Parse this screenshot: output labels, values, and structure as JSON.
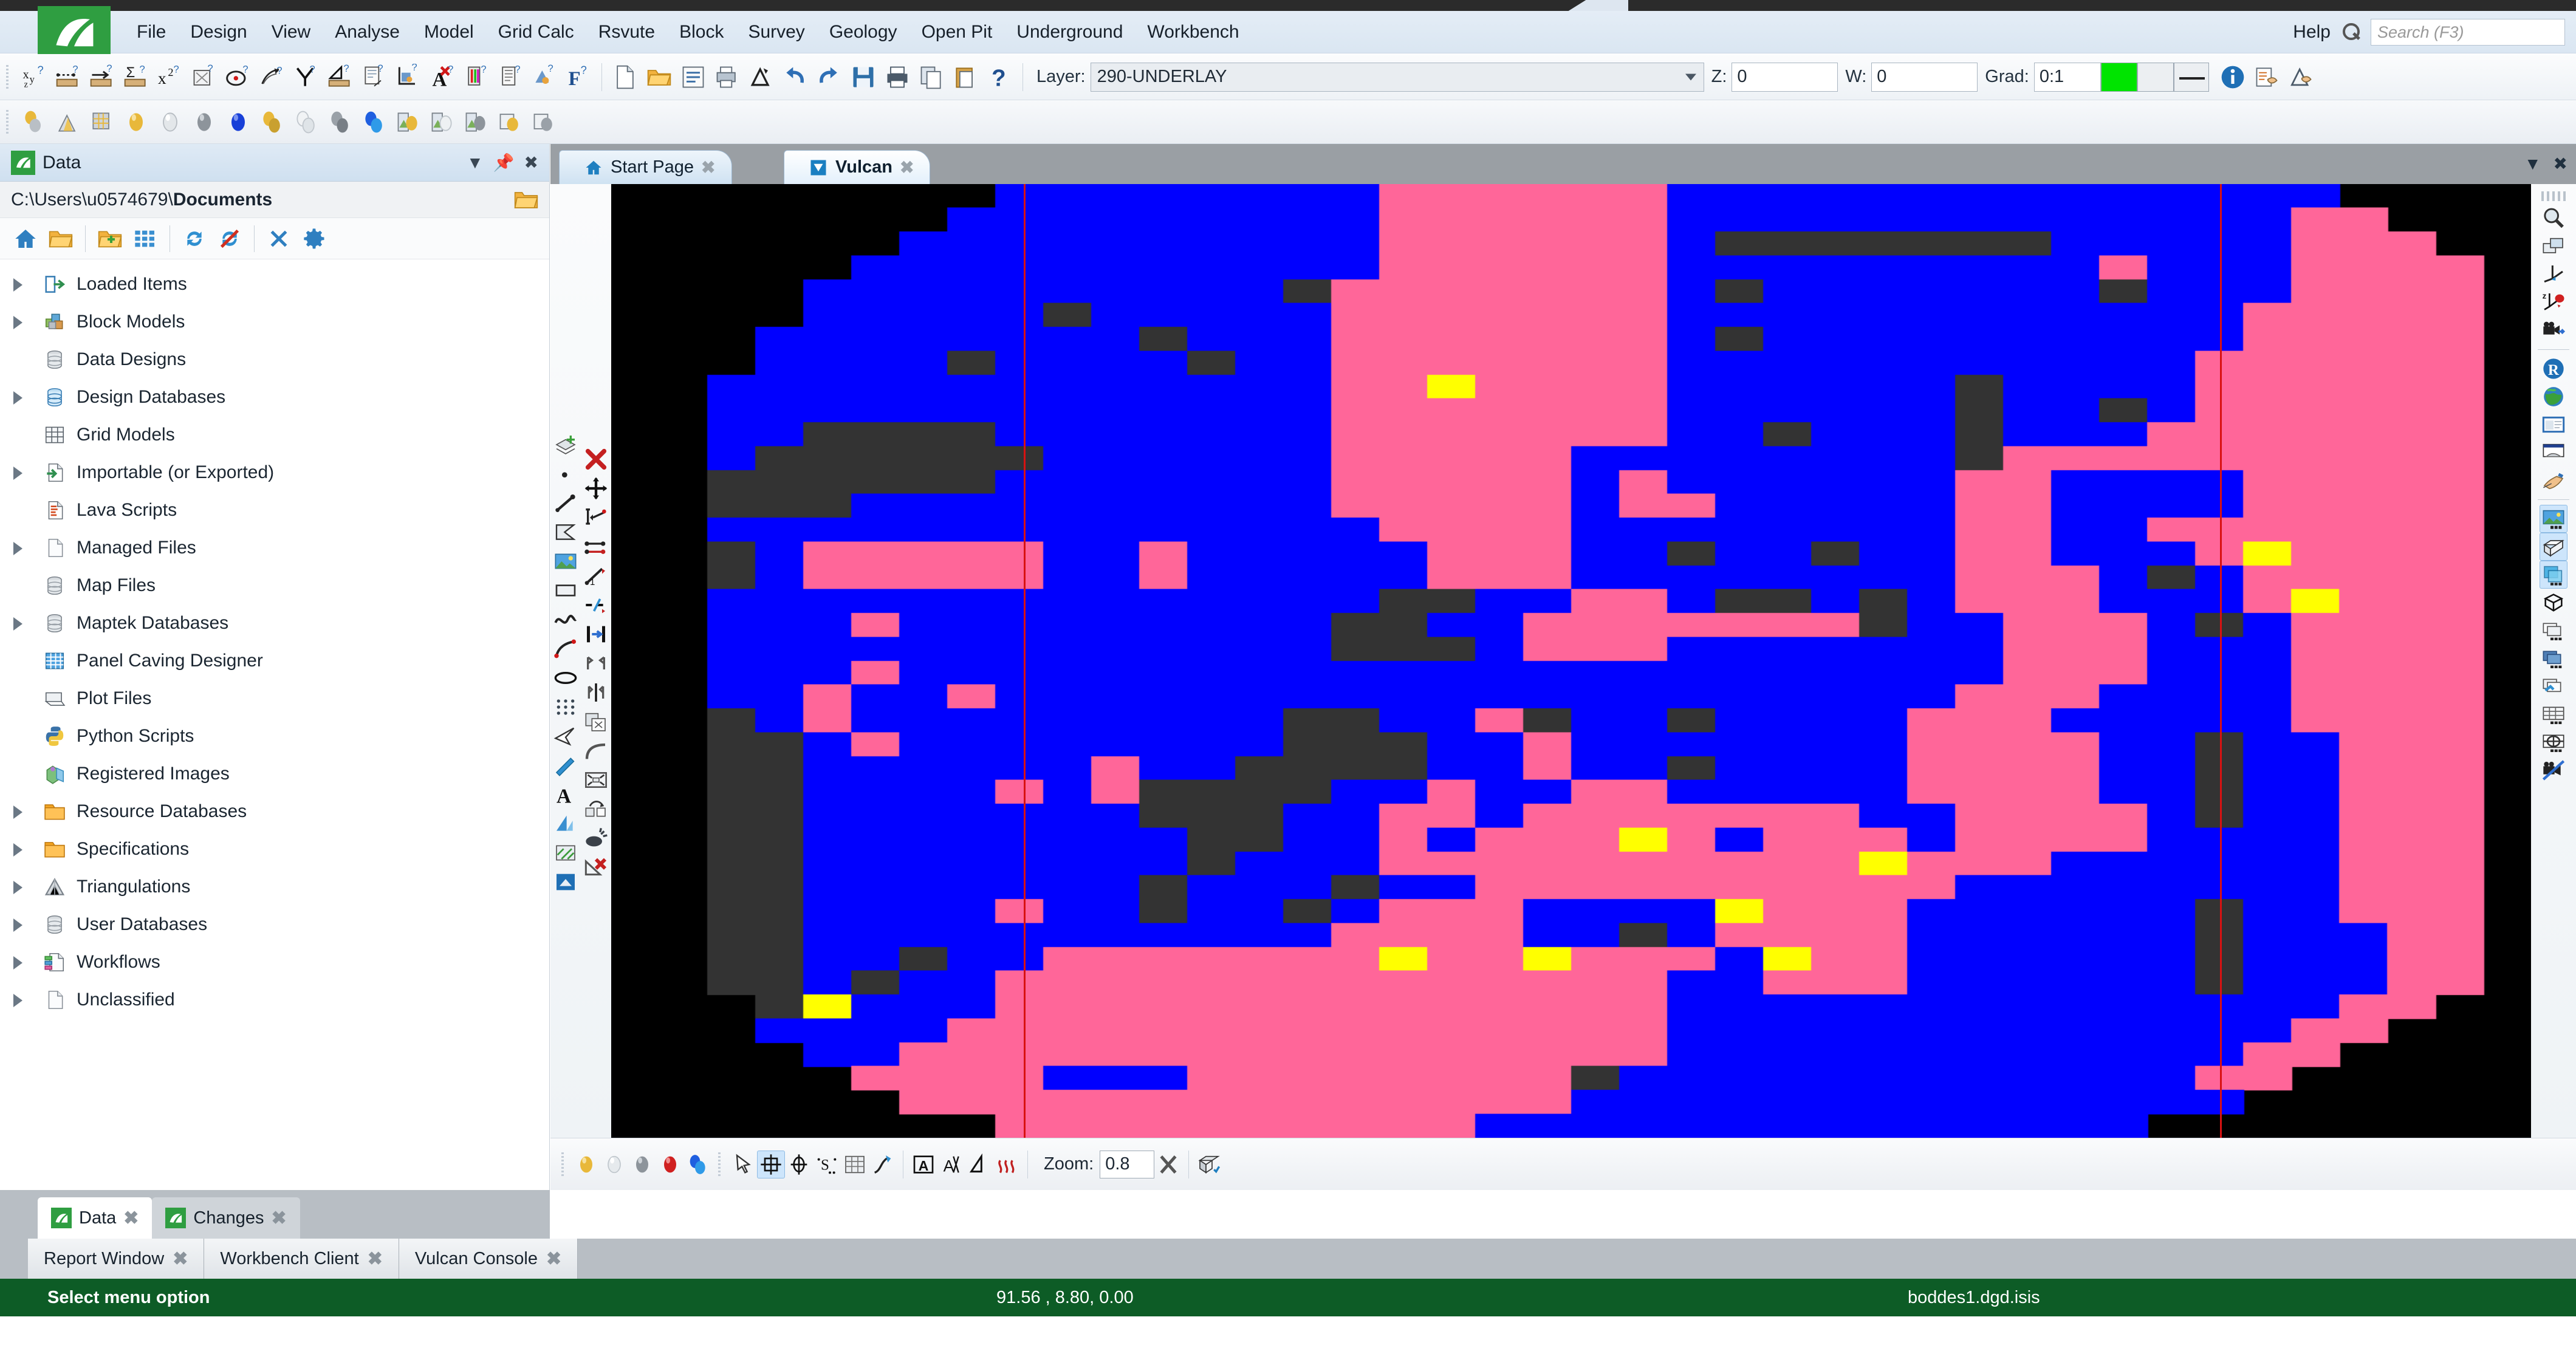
{
  "app": {
    "logo_alt": "maptek-vulcan-logo",
    "menu": [
      "File",
      "Design",
      "View",
      "Analyse",
      "Model",
      "Grid Calc",
      "Rsvute",
      "Block",
      "Survey",
      "Geology",
      "Open Pit",
      "Underground",
      "Workbench"
    ],
    "help_label": "Help",
    "search": {
      "placeholder": "Search (F3)",
      "value": ""
    }
  },
  "toolbar": {
    "layer_label": "Layer:",
    "layer_value": "290-UNDERLAY",
    "z_label": "Z:",
    "z_value": "0",
    "w_label": "W:",
    "w_value": "0",
    "grad_label": "Grad:",
    "grad_value": "0:1",
    "grad_color": "#00e400",
    "row1_icons": [
      "xyz-label-icon",
      "distance-measure-icon",
      "arrow-measure-icon",
      "sum-measure-icon",
      "x-squared-icon",
      "area-query-icon",
      "point-query-icon",
      "surface-query-icon",
      "angle-query-icon",
      "triangle-measure-icon",
      "document-measure-icon",
      "chart-axis-icon",
      "delete-text-icon",
      "colour-legend-icon",
      "report-icon",
      "legend-edit-icon",
      "formula-icon"
    ],
    "row2_icons": [
      "spheres-icon",
      "triangulation-icon",
      "grid-model-icon",
      "gold-sphere-icon",
      "white-sphere-icon",
      "grey-sphere-icon",
      "blue-sphere-icon",
      "gold-spheres-icon",
      "white-spheres-icon",
      "grey-spheres-icon",
      "blue-spheres-icon",
      "gold-section-icon",
      "white-section-icon",
      "grey-section-icon",
      "gold-copy-icon",
      "grey-copy-icon"
    ],
    "file_icons": [
      "new-file-icon",
      "open-folder-icon",
      "list-icon",
      "print-preview-icon",
      "delta-icon",
      "undo-icon",
      "redo-icon",
      "save-icon",
      "print-icon",
      "copy-icon",
      "paste-icon",
      "help-question-icon"
    ],
    "right_icons": [
      "info-icon",
      "properties-icon",
      "edit-properties-icon"
    ]
  },
  "data_panel": {
    "title": "Data",
    "icon": "vulcan-leaf-icon",
    "path_prefix": "C:\\Users\\u0574679\\",
    "path_bold": "Documents",
    "pin_icon": "pin-icon",
    "close_icon": "close-icon",
    "dropdown_icon": "chevron-down-icon",
    "folder_icon": "folder-open-icon",
    "tools": [
      "home-icon",
      "open-folder-icon",
      "new-folder-icon",
      "grid-view-icon",
      "refresh-icon",
      "refresh-off-icon",
      "collapse-icon",
      "settings-gear-icon"
    ],
    "tree": [
      {
        "label": "Loaded Items",
        "icon": "loaded-items-icon",
        "expandable": true
      },
      {
        "label": "Block Models",
        "icon": "block-models-icon",
        "expandable": true
      },
      {
        "label": "Data Designs",
        "icon": "database-grey-icon",
        "expandable": false
      },
      {
        "label": "Design Databases",
        "icon": "database-blue-icon",
        "expandable": true
      },
      {
        "label": "Grid Models",
        "icon": "grid-models-icon",
        "expandable": false
      },
      {
        "label": "Importable (or Exported)",
        "icon": "import-file-icon",
        "expandable": true
      },
      {
        "label": "Lava Scripts",
        "icon": "lava-script-icon",
        "expandable": false
      },
      {
        "label": "Managed Files",
        "icon": "file-blank-icon",
        "expandable": true
      },
      {
        "label": "Map Files",
        "icon": "database-grey-icon",
        "expandable": false
      },
      {
        "label": "Maptek Databases",
        "icon": "database-grey-icon",
        "expandable": true
      },
      {
        "label": "Panel Caving Designer",
        "icon": "panel-caving-icon",
        "expandable": false
      },
      {
        "label": "Plot Files",
        "icon": "plot-file-icon",
        "expandable": false
      },
      {
        "label": "Python Scripts",
        "icon": "python-icon",
        "expandable": false
      },
      {
        "label": "Registered Images",
        "icon": "registered-images-icon",
        "expandable": false
      },
      {
        "label": "Resource Databases",
        "icon": "folder-orange-icon",
        "expandable": true
      },
      {
        "label": "Specifications",
        "icon": "folder-orange-icon",
        "expandable": true
      },
      {
        "label": "Triangulations",
        "icon": "triangulation-icon",
        "expandable": true
      },
      {
        "label": "User Databases",
        "icon": "database-grey-icon",
        "expandable": true
      },
      {
        "label": "Workflows",
        "icon": "workflow-icon",
        "expandable": true
      },
      {
        "label": "Unclassified",
        "icon": "file-blank-icon",
        "expandable": true
      }
    ],
    "dock_tabs": [
      {
        "label": "Data",
        "active": true,
        "icon": "vulcan-leaf-icon",
        "close": "✖"
      },
      {
        "label": "Changes",
        "active": false,
        "icon": "vulcan-leaf-icon",
        "close": "✖"
      }
    ]
  },
  "viewport": {
    "tabs": [
      {
        "label": "Start Page",
        "icon": "home-icon",
        "active": false,
        "close": "✖"
      },
      {
        "label": "Vulcan",
        "icon": "vulcan-triangle-icon",
        "active": true,
        "close": "✖"
      }
    ],
    "tabbar_right": {
      "minimise": "▼",
      "close": "✖"
    },
    "left_tools_col1": [
      "add-layer-icon",
      "point-icon",
      "line-icon",
      "polygon-icon",
      "image-icon",
      "rectangle-icon",
      "spline-icon",
      "arc-icon",
      "ellipse-icon",
      "point-array-icon",
      "select-arrow-icon",
      "blue-arrow-icon",
      "text-icon",
      "extrude-icon",
      "hatch-icon",
      "solid-icon"
    ],
    "left_tools_col2": [
      "delete-red-x-icon",
      "move-icon",
      "snap-icon",
      "edit-points-icon",
      "offset-icon",
      "trim-icon",
      "extend-icon",
      "mirror-icon",
      "split-icon",
      "copy-object-icon",
      "curve-icon",
      "scale-icon",
      "duplicate-icon",
      "explode-icon",
      "delete-triangle-icon"
    ],
    "right_tools": [
      "zoom-icon",
      "window-zoom-icon",
      "axis-view-icon",
      "z-axis-rotate-icon",
      "camera-icon",
      "reset-view-icon",
      "globe-icon",
      "layout-icon",
      "presentation-icon",
      "pan-hand-icon",
      "image-display-icon",
      "solid-display-icon",
      "transparency-icon",
      "wireframe-icon",
      "layers-white-icon",
      "layers-blue-icon",
      "layers-edit-icon",
      "grid-display-icon",
      "section-display-icon",
      "camera-off-icon"
    ],
    "bottom_tools": [
      "gold-sphere-icon",
      "white-sphere-icon",
      "grey-sphere-icon",
      "red-sphere-icon",
      "blue-spheres-icon",
      "cursor-arrow-icon",
      "crosshair-grid-icon",
      "target-icon",
      "snap-point-icon",
      "grid-snap-icon",
      "pen-snap-icon",
      "text-box-icon",
      "dimension-icon",
      "angle-icon",
      "contour-icon"
    ],
    "zoom_label": "Zoom:",
    "zoom_value": "0.8",
    "zoom_reset_icon": "clear-x-icon",
    "section_icon": "section-box-icon",
    "selected_tool": "crosshair-grid-icon",
    "guide_color": "#d81212",
    "background": "#000000",
    "palette": {
      "blue": "#0000FF",
      "pink": "#FF6699",
      "grey": "#333333",
      "yellow": "#FFFF00",
      "black": "#000000"
    },
    "grid": {
      "cols": 40,
      "rows": 40,
      "legend": {
        "B": "blue",
        "P": "pink",
        "G": "grey",
        "Y": "yellow",
        ".": "black"
      },
      "rows_data": [
        "........BBBBBBBBPPPPPPBBBBBBBBBBBBBB....",
        ".......BBBBBBBBBPPPPPPBBBBBBBBBBBBBPP...",
        "......BBBBBBBBBBPPPPPPBGGGGGGGBBBBBPPP..",
        ".....BBBBBBBBBBBPPPPPPBBBBBBBBBPBBBPPPP.",
        "....BBBBBBBBBBGPPPPPPPBGBBBBBBBGBBBPPPP.",
        "....BBBBBGBBBBBPPPPPPPBBBBBBBBBBBBPPPPP.",
        "...BBBBBBBBGBBBPPPPPPPBGBBBBBBBBBBPPPPP.",
        "...BBBBGBBBBGBBPPPPPPPBBBBBBBBBBBPPPPPP.",
        "..BBBBBBBBBBBBBPPYPPPPBBBBBBGBBBBPPPPPP.",
        "..BBBBBBBBBBBBBPPPPPPPBBBBBBGBBGBPPPPPP.",
        "..BBGGGGBBBBBBBPPPPPPPBBGBBBGBBBPPPPPPP.",
        "..BGGGGGGBBBBBBPPPPPBBBBBBBBGPPPPPPPPPP.",
        "..GGGGGGBBBBBBBPPPPPBPBBBBBBPPBBBBPPPPP.",
        "..GGGBBBBBBBBBBPPPPPBPPBBBBBPPBBBBPPPPP.",
        "..BBBBBBBBBBBBBBPPPPBBBBBBBBPPBBPPPPPPP.",
        "..GBPPPPPBBPBBBBBPPPBBGBBGBBPPBBBPYPPPP.",
        "..GBPPPPPBBPBBBBBPPPBBBBBBBBPPPBGBPPPPP.",
        "..BBBBBBBBBBBBBBGGBBPPBGGBGBPPPBBBPYPPP.",
        "..BBBPBBBBBBBBBGGBBPPPPPPPGBBPPPBGBPPPP.",
        "..BBBBBBBBBBBBBGGGBPPPBBBBBBBPPPBBBPPPP.",
        "..BBBPBBBBBBBBBBBBBBBBBBBBBBBPPPBBBPPPP.",
        "..BBPBBPBBBBBBBBBBBBBBBBBBBBPPPBBBBPPPP.",
        "..GBPBBBBBBBBBGGBBPGBBGBBBBPPPBBBBBPPPP.",
        "..GGBPBBBBBBBBGGGBBPBBBBBBBPPPPBBGBBPPP.",
        "..GGBBBBBBPBBGGGGBBPBBGBBBBPPPPBBGBBPPP.",
        "..GGBBBBPBPGGGGBBPBBPPBBBBBPPPPBBGBBPPP.",
        "..GGBBBBBBBGGGBBPPBPPPPPPPBBPPPPBGBBPPP.",
        "..GGBBBBBBBBGGBBPBPPPYPBPPPBPPPPBBBBPPP.",
        "..GGBBBBBBBBGBBBPPPPPPPPPPYPPPBBBBBBPPP.",
        "..GGBBBBBBBGBBBGBBPPPPPPPPPPBBBBBBBBPPP.",
        "..GGBBBBPBBGBBGBPPPBBBBYPPPBBBBBBGBBPPP.",
        "..GGBBBBBBBBBBBPPPPBBGBPPPPBBBBBBGBBBPP.",
        "..GGBBGBBPPPPPPPYPPYPPPBYPPBBBBBBGBBBPP.",
        "..GGBGBBPPPPPPPPPPPPPPBBPPPBBBBBBGBBBPP.",
        "...GYBBBPPPPPPPPPPPPPPBBBBBBBBBBBBBBPP..",
        "...BBBBPPPPPPPPPPPPPPPBBBBBBBBBBBBBPP...",
        "....BBPPPPPPPPPPPPPPPPBBBBBBBBBBBBPP....",
        ".....PPPPBBBPPPPPPPPGBBBBBBBBBBBBPP.....",
        "......PPPPPPPPPPPPPPBBBBBBBBBBBBBB......",
        "........PPPPPPPPPPBBBBBBBBBBBBBB........"
      ]
    }
  },
  "window_tabs": [
    {
      "label": "Report Window",
      "close": "✖"
    },
    {
      "label": "Workbench Client",
      "close": "✖"
    },
    {
      "label": "Vulcan Console",
      "close": "✖"
    }
  ],
  "statusbar": {
    "message": "Select menu option",
    "coordinates": "91.56 , 8.80, 0.00",
    "file": "boddes1.dgd.isis",
    "background": "#0d5c26"
  }
}
